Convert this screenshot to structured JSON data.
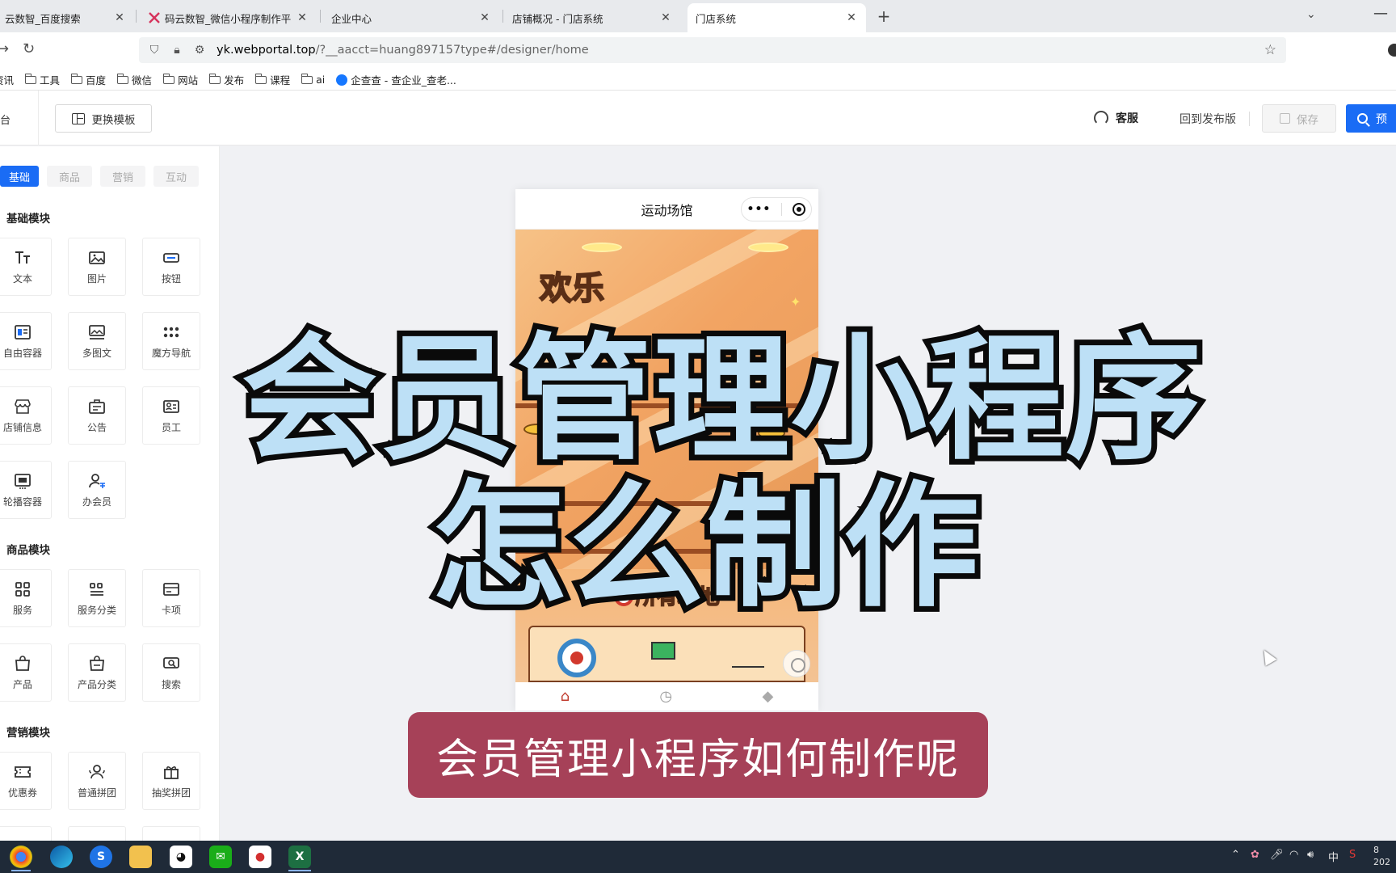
{
  "browser": {
    "tabs": [
      {
        "title": "云数智_百度搜索",
        "active": false
      },
      {
        "title": "码云数智_微信小程序制作平台_",
        "active": false
      },
      {
        "title": "企业中心",
        "active": false
      },
      {
        "title": "店铺概况 - 门店系统",
        "active": false
      },
      {
        "title": "门店系统",
        "active": true
      }
    ],
    "close_glyph": "✕",
    "new_tab_glyph": "+",
    "address": {
      "host": "yk.webportal.top",
      "path": "/?__aacct=huang897157type#/designer/home"
    },
    "bookmarks": [
      {
        "label": "资讯",
        "kind": "text"
      },
      {
        "label": "工具",
        "kind": "folder"
      },
      {
        "label": "百度",
        "kind": "folder"
      },
      {
        "label": "微信",
        "kind": "folder"
      },
      {
        "label": "网站",
        "kind": "folder"
      },
      {
        "label": "发布",
        "kind": "folder"
      },
      {
        "label": "课程",
        "kind": "folder"
      },
      {
        "label": "ai",
        "kind": "folder"
      },
      {
        "label": "企查查 - 查企业_查老...",
        "kind": "site"
      }
    ]
  },
  "header": {
    "left_fragment": "台",
    "template_button": "更换模板",
    "customer_service": "客服",
    "back_to_release": "回到发布版",
    "save": "保存",
    "preview": "预"
  },
  "panel": {
    "tabs": [
      "基础",
      "商品",
      "营销",
      "互动"
    ],
    "active_tab": "基础",
    "groups": [
      {
        "title": "基础模块",
        "items": [
          {
            "label": "文本",
            "icon": "text-icon"
          },
          {
            "label": "图片",
            "icon": "image-icon"
          },
          {
            "label": "按钮",
            "icon": "button-icon"
          },
          {
            "label": "自由容器",
            "icon": "container-icon"
          },
          {
            "label": "多图文",
            "icon": "multi-image-icon"
          },
          {
            "label": "魔方导航",
            "icon": "grid-dots-icon"
          },
          {
            "label": "店铺信息",
            "icon": "store-icon"
          },
          {
            "label": "公告",
            "icon": "notice-icon"
          },
          {
            "label": "员工",
            "icon": "staff-card-icon"
          },
          {
            "label": "轮播容器",
            "icon": "carousel-icon"
          },
          {
            "label": "办会员",
            "icon": "member-icon"
          }
        ]
      },
      {
        "title": "商品模块",
        "items": [
          {
            "label": "服务",
            "icon": "service-grid-icon"
          },
          {
            "label": "服务分类",
            "icon": "service-category-icon"
          },
          {
            "label": "卡项",
            "icon": "card-icon"
          },
          {
            "label": "产品",
            "icon": "bag-icon"
          },
          {
            "label": "产品分类",
            "icon": "bag-category-icon"
          },
          {
            "label": "搜索",
            "icon": "search-box-icon"
          }
        ]
      },
      {
        "title": "营销模块",
        "items": [
          {
            "label": "优惠券",
            "icon": "coupon-icon"
          },
          {
            "label": "普通拼团",
            "icon": "group-buy-icon"
          },
          {
            "label": "抽奖拼团",
            "icon": "gift-icon"
          }
        ]
      }
    ]
  },
  "phone": {
    "title": "运动场馆",
    "capsule_dots": "•••",
    "banner_text": "欢乐",
    "venue_title": "所有场地"
  },
  "overlay": {
    "line1": "会员管理小程序",
    "line2": "怎么制作",
    "subtitle": "会员管理小程序如何制作呢"
  },
  "taskbar": {
    "ime": "中",
    "clock_line1": "8",
    "clock_line2": "202"
  },
  "colors": {
    "accent": "#1a6cf5",
    "overlay_fill": "#bde0f6",
    "subtitle_bg": "#a64158",
    "tab_active_icon": "#c0392b"
  }
}
